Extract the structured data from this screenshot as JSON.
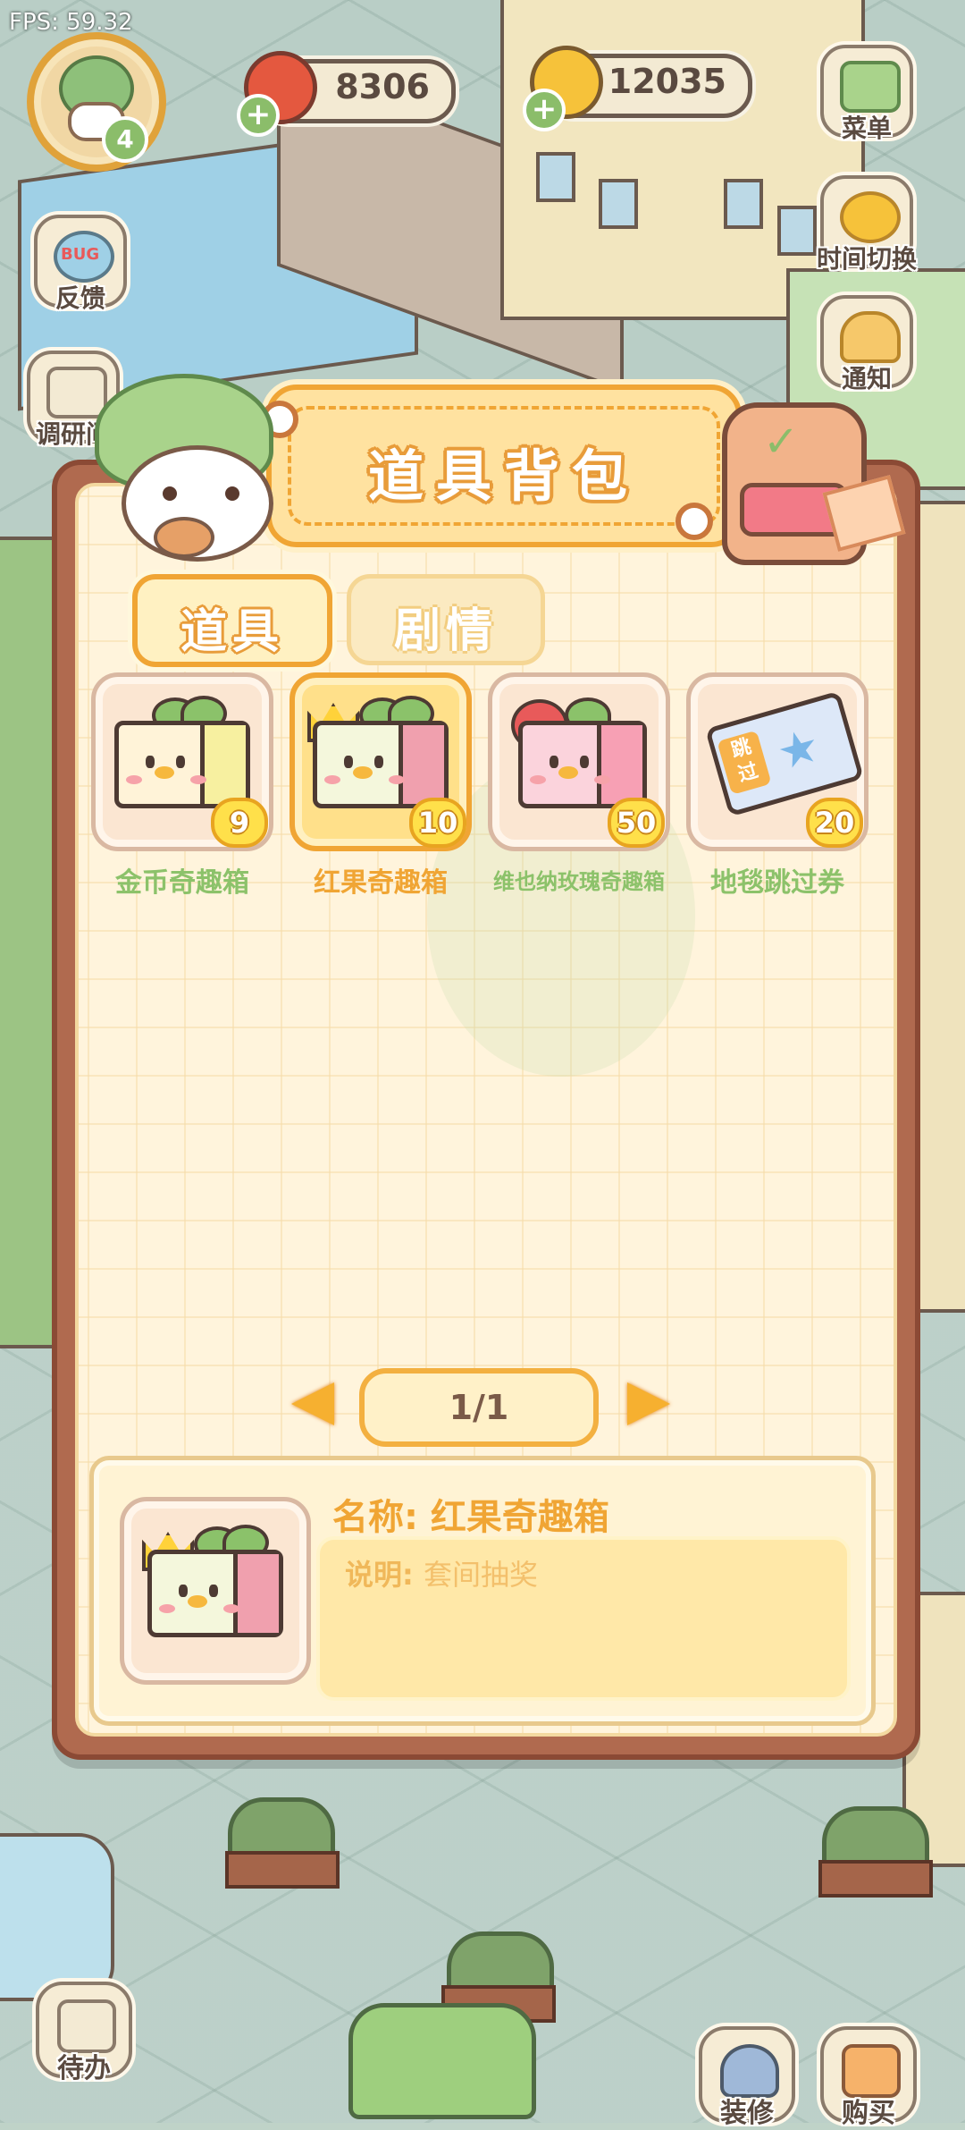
{
  "hud": {
    "fps": "FPS: 59.32",
    "level": "4",
    "red_fruit": "8306",
    "coins": "12035"
  },
  "side_buttons": {
    "menu": "菜单",
    "time_switch": "时间切换",
    "notice": "通知",
    "feedback": "反馈",
    "feedback_badge": "BUG",
    "research": "调研问"
  },
  "panel": {
    "title": "道具背包",
    "tabs": [
      {
        "label": "道具",
        "active": true
      },
      {
        "label": "剧情",
        "active": false
      }
    ],
    "items": [
      {
        "name": "金币奇趣箱",
        "count": "9",
        "name_color": "#8cc26a"
      },
      {
        "name": "红果奇趣箱",
        "count": "10",
        "name_color": "#f0a534"
      },
      {
        "name": "维也纳玫瑰奇趣箱",
        "count": "50",
        "name_color": "#8cc26a"
      },
      {
        "name": "地毯跳过券",
        "count": "20",
        "name_color": "#8cc26a"
      }
    ],
    "ticket_text": "跳过",
    "pager": "1/1",
    "detail": {
      "name_label": "名称: 红果奇趣箱",
      "desc_label": "说明:",
      "desc_value": "套间抽奖"
    }
  },
  "bottom_buttons": {
    "todo": "待办",
    "decorate": "装修",
    "buy": "购买"
  },
  "colors": {
    "accent": "#f0a534",
    "green_text": "#8cc26a",
    "panel_frame": "#b06a4f"
  }
}
